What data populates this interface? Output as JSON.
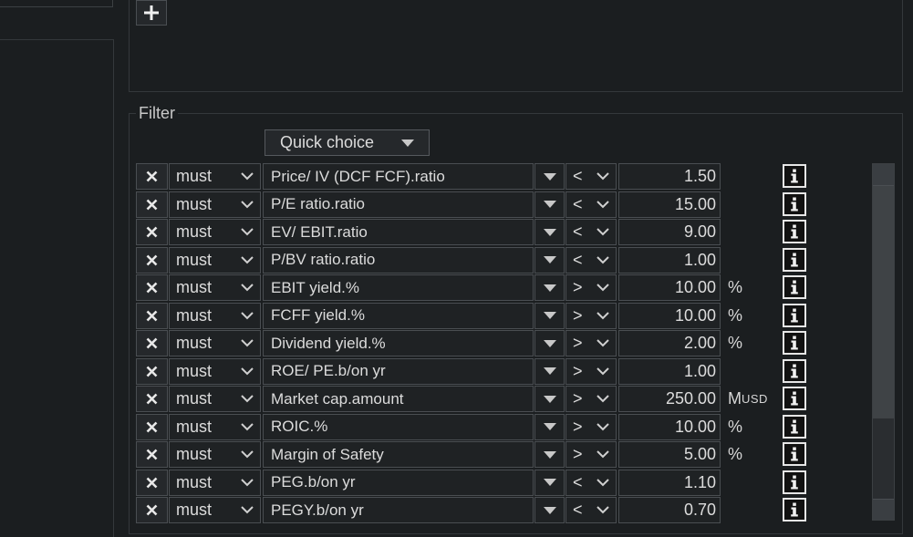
{
  "filter": {
    "legend": "Filter",
    "quick_choice_label": "Quick choice",
    "rows": [
      {
        "must": "must",
        "field": "Price/ IV (DCF FCF).ratio",
        "op": "<",
        "value": "1.50",
        "unit": "",
        "unit_small": ""
      },
      {
        "must": "must",
        "field": "P/E ratio.ratio",
        "op": "<",
        "value": "15.00",
        "unit": "",
        "unit_small": ""
      },
      {
        "must": "must",
        "field": "EV/ EBIT.ratio",
        "op": "<",
        "value": "9.00",
        "unit": "",
        "unit_small": ""
      },
      {
        "must": "must",
        "field": "P/BV ratio.ratio",
        "op": "<",
        "value": "1.00",
        "unit": "",
        "unit_small": ""
      },
      {
        "must": "must",
        "field": "EBIT yield.%",
        "op": ">",
        "value": "10.00",
        "unit": "%",
        "unit_small": ""
      },
      {
        "must": "must",
        "field": "FCFF yield.%",
        "op": ">",
        "value": "10.00",
        "unit": "%",
        "unit_small": ""
      },
      {
        "must": "must",
        "field": "Dividend yield.%",
        "op": ">",
        "value": "2.00",
        "unit": "%",
        "unit_small": ""
      },
      {
        "must": "must",
        "field": "ROE/ PE.b/on yr",
        "op": ">",
        "value": "1.00",
        "unit": "",
        "unit_small": ""
      },
      {
        "must": "must",
        "field": "Market cap.amount",
        "op": ">",
        "value": "250.00",
        "unit": "M",
        "unit_small": "USD"
      },
      {
        "must": "must",
        "field": "ROIC.%",
        "op": ">",
        "value": "10.00",
        "unit": "%",
        "unit_small": ""
      },
      {
        "must": "must",
        "field": "Margin of Safety",
        "op": ">",
        "value": "5.00",
        "unit": "%",
        "unit_small": ""
      },
      {
        "must": "must",
        "field": "PEG.b/on yr",
        "op": "<",
        "value": "1.10",
        "unit": "",
        "unit_small": ""
      },
      {
        "must": "must",
        "field": "PEGY.b/on yr",
        "op": "<",
        "value": "0.70",
        "unit": "",
        "unit_small": ""
      }
    ]
  },
  "icons": {
    "add": "plus-icon",
    "delete": "close-icon",
    "dropdown": "chevron-down-icon",
    "field_dropdown": "triangle-down-icon",
    "info": "info-icon"
  },
  "colors": {
    "background": "#1b1e20",
    "border": "#4a4e52",
    "text": "#dcdcdc"
  }
}
